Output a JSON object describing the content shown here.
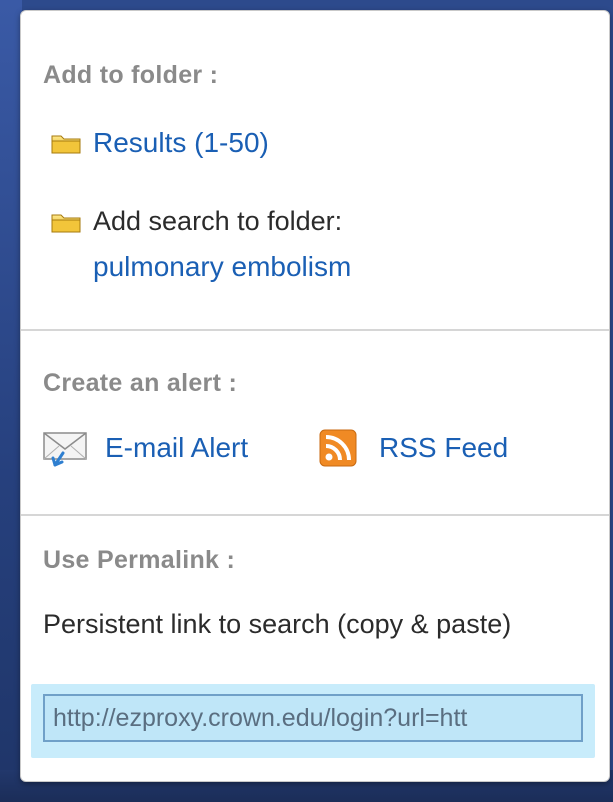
{
  "folder": {
    "heading": "Add to folder :",
    "results_link": "Results (1-50)",
    "add_search_label": "Add search to folder:",
    "search_term_link": "pulmonary embolism"
  },
  "alert": {
    "heading": "Create an alert :",
    "email_link": "E-mail Alert",
    "rss_link": "RSS Feed"
  },
  "permalink": {
    "heading": "Use Permalink :",
    "description": "Persistent link to search (copy & paste)",
    "url_value": "http://ezproxy.crown.edu/login?url=htt"
  },
  "icons": {
    "folder": "folder-icon",
    "email": "email-alert-icon",
    "rss": "rss-icon"
  },
  "colors": {
    "link": "#1a5fb4",
    "heading": "#8a8a8a",
    "rss": "#f08a24",
    "permalink_highlight": "#c8ecfb"
  }
}
